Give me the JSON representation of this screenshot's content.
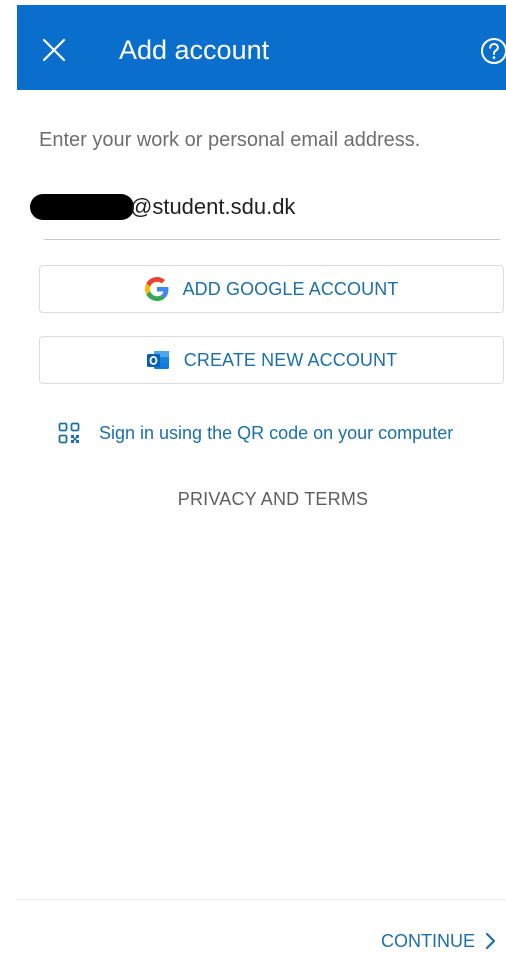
{
  "header": {
    "title": "Add account",
    "background_color": "#0a6fcc",
    "close_icon": "close-icon",
    "help_icon": "help-icon"
  },
  "instruction": "Enter your work or personal email address.",
  "email": {
    "value": "@student.sdu.dk"
  },
  "buttons": {
    "google": {
      "label": "ADD GOOGLE ACCOUNT",
      "icon": "google-icon"
    },
    "create": {
      "label": "CREATE NEW ACCOUNT",
      "icon": "outlook-icon"
    }
  },
  "qr_link": {
    "label": "Sign in using the QR code on your computer",
    "icon": "qr-code-icon"
  },
  "privacy_link": "PRIVACY AND TERMS",
  "footer": {
    "continue_label": "CONTINUE",
    "continue_icon": "chevron-right-icon"
  },
  "colors": {
    "accent": "#1c6fa9",
    "header": "#0a6fcc"
  }
}
